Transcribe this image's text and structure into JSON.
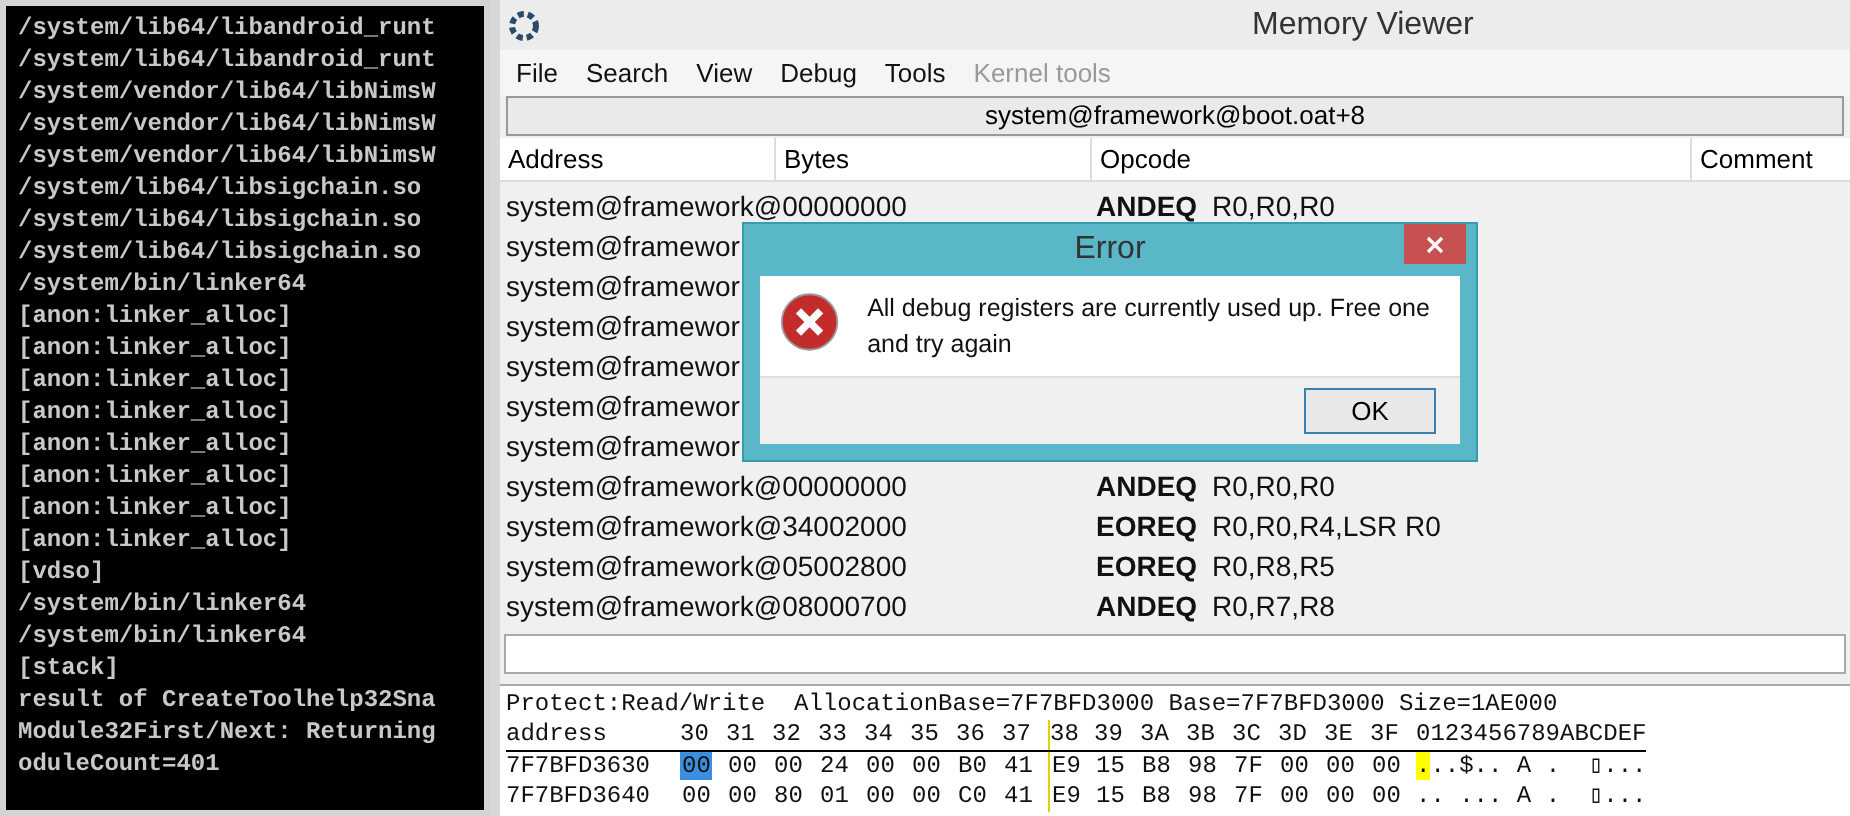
{
  "console": {
    "lines": [
      "/system/lib64/libandroid_runt",
      "/system/lib64/libandroid_runt",
      "/system/vendor/lib64/libNimsW",
      "/system/vendor/lib64/libNimsW",
      "/system/vendor/lib64/libNimsW",
      "/system/lib64/libsigchain.so",
      "/system/lib64/libsigchain.so",
      "/system/lib64/libsigchain.so",
      "/system/bin/linker64",
      "[anon:linker_alloc]",
      "[anon:linker_alloc]",
      "[anon:linker_alloc]",
      "[anon:linker_alloc]",
      "[anon:linker_alloc]",
      "[anon:linker_alloc]",
      "[anon:linker_alloc]",
      "[anon:linker_alloc]",
      "[vdso]",
      "/system/bin/linker64",
      "/system/bin/linker64",
      "[stack]",
      "result of CreateToolhelp32Sna",
      "Module32First/Next: Returning",
      "oduleCount=401"
    ]
  },
  "window": {
    "title": "Memory Viewer"
  },
  "menu": [
    {
      "label": "File",
      "disabled": false
    },
    {
      "label": "Search",
      "disabled": false
    },
    {
      "label": "View",
      "disabled": false
    },
    {
      "label": "Debug",
      "disabled": false
    },
    {
      "label": "Tools",
      "disabled": false
    },
    {
      "label": "Kernel tools",
      "disabled": true
    }
  ],
  "address_bar": {
    "value": "system@framework@boot.oat+8"
  },
  "disassembly": {
    "columns": [
      "Address",
      "Bytes",
      "Opcode",
      "Comment"
    ],
    "rows": [
      {
        "address": "system@framework@00000000",
        "mnemonic": "ANDEQ",
        "operands": "R0,R0,R0"
      },
      {
        "address": "system@framewor"
      },
      {
        "address": "system@framewor"
      },
      {
        "address": "system@framewor"
      },
      {
        "address": "system@framewor"
      },
      {
        "address": "system@framewor"
      },
      {
        "address": "system@framewor"
      },
      {
        "address": "system@framework@00000000",
        "mnemonic": "ANDEQ",
        "operands": "R0,R0,R0"
      },
      {
        "address": "system@framework@34002000",
        "mnemonic": "EOREQ",
        "operands": "R0,R0,R4,LSR R0"
      },
      {
        "address": "system@framework@05002800",
        "mnemonic": "EOREQ",
        "operands": "R0,R8,R5"
      },
      {
        "address": "system@framework@08000700",
        "mnemonic": "ANDEQ",
        "operands": "R0,R7,R8"
      }
    ]
  },
  "hex_view": {
    "info": "Protect:Read/Write  AllocationBase=7F7BFD3000 Base=7F7BFD3000 Size=1AE000",
    "header": {
      "label": "address",
      "columns": [
        "30",
        "31",
        "32",
        "33",
        "34",
        "35",
        "36",
        "37",
        "38",
        "39",
        "3A",
        "3B",
        "3C",
        "3D",
        "3E",
        "3F"
      ],
      "ascii": "0123456789ABCDEF"
    },
    "rows": [
      {
        "address": "7F7BFD3630",
        "bytes": [
          {
            "text": "00",
            "selected": true
          },
          {
            "text": "00",
            "selected": false
          },
          {
            "text": "00",
            "selected": false
          },
          {
            "text": "24",
            "selected": false
          },
          {
            "text": "00",
            "selected": false
          },
          {
            "text": "00",
            "selected": false
          },
          {
            "text": "B0",
            "selected": false
          },
          {
            "text": "41",
            "selected": false
          },
          {
            "text": "E9",
            "selected": false
          },
          {
            "text": "15",
            "selected": false
          },
          {
            "text": "B8",
            "selected": false
          },
          {
            "text": "98",
            "selected": false
          },
          {
            "text": "7F",
            "selected": false
          },
          {
            "text": "00",
            "selected": false
          },
          {
            "text": "00",
            "selected": false
          },
          {
            "text": "00",
            "selected": false
          }
        ],
        "ascii": "...$.. A .  ▯...",
        "ascii_cursor": true
      },
      {
        "address": "7F7BFD3640",
        "bytes": [
          {
            "text": "00",
            "selected": false
          },
          {
            "text": "00",
            "selected": false
          },
          {
            "text": "80",
            "selected": false
          },
          {
            "text": "01",
            "selected": false
          },
          {
            "text": "00",
            "selected": false
          },
          {
            "text": "00",
            "selected": false
          },
          {
            "text": "C0",
            "selected": false
          },
          {
            "text": "41",
            "selected": false
          },
          {
            "text": "E9",
            "selected": false
          },
          {
            "text": "15",
            "selected": false
          },
          {
            "text": "B8",
            "selected": false
          },
          {
            "text": "98",
            "selected": false
          },
          {
            "text": "7F",
            "selected": false
          },
          {
            "text": "00",
            "selected": false
          },
          {
            "text": "00",
            "selected": false
          },
          {
            "text": "00",
            "selected": false
          }
        ],
        "ascii": ".. ... A .  ▯...",
        "ascii_cursor": false
      }
    ]
  },
  "dialog": {
    "title": "Error",
    "message": "All debug registers are currently used up. Free one and try again",
    "button": "OK"
  }
}
